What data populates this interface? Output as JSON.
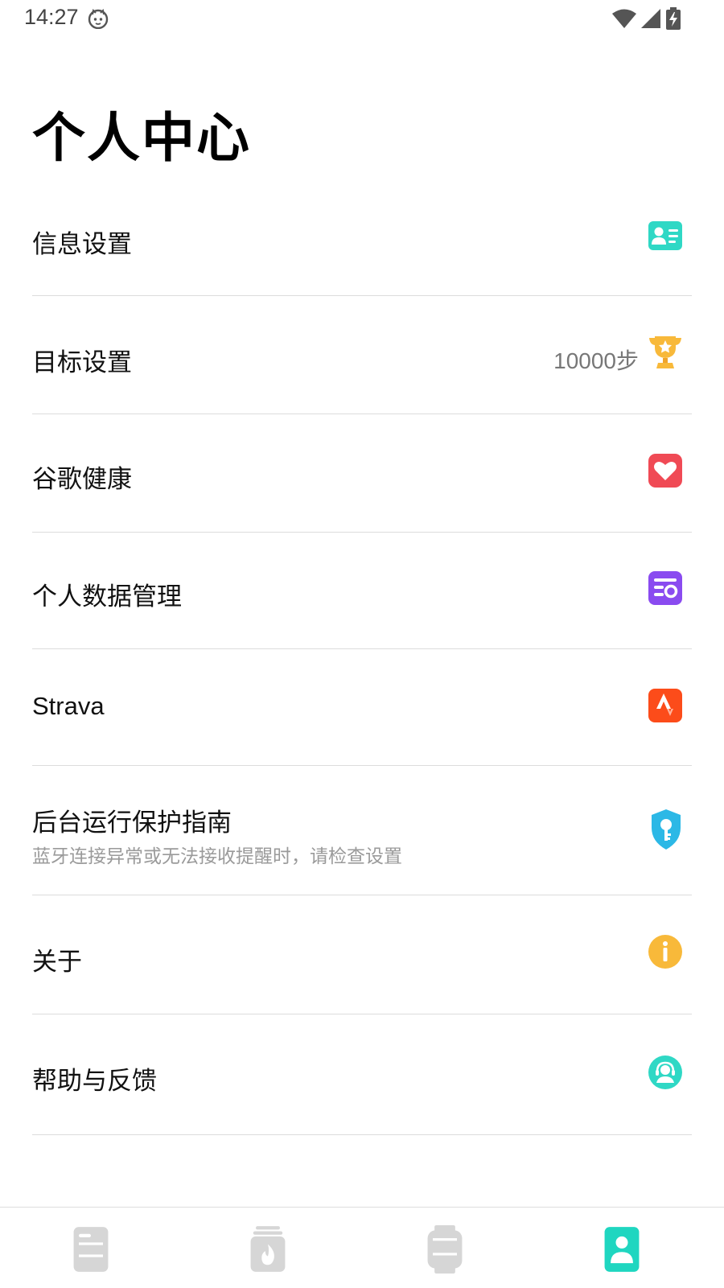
{
  "status_bar": {
    "time": "14:27"
  },
  "header": {
    "title": "个人中心"
  },
  "menu": {
    "items": [
      {
        "label": "信息设置",
        "icon": "id-card-icon",
        "color": "#2fd8c5"
      },
      {
        "label": "目标设置",
        "value": "10000步",
        "icon": "trophy-icon",
        "color": "#f8b93a"
      },
      {
        "label": "谷歌健康",
        "icon": "heart-icon",
        "color": "#f04a55"
      },
      {
        "label": "个人数据管理",
        "icon": "data-manage-icon",
        "color": "#8a4bf0"
      },
      {
        "label": "Strava",
        "icon": "strava-icon",
        "color": "#fc4c1a"
      },
      {
        "label": "后台运行保护指南",
        "sub": "蓝牙连接异常或无法接收提醒时，请检查设置",
        "icon": "shield-key-icon",
        "color": "#2cb8e6"
      },
      {
        "label": "关于",
        "icon": "info-icon",
        "color": "#f8b93a"
      },
      {
        "label": "帮助与反馈",
        "icon": "support-agent-icon",
        "color": "#2fd8c5"
      }
    ]
  },
  "bottom_nav": {
    "items": [
      {
        "icon": "dashboard-icon",
        "active": false
      },
      {
        "icon": "calories-icon",
        "active": false
      },
      {
        "icon": "watch-icon",
        "active": false
      },
      {
        "icon": "profile-icon",
        "active": true
      }
    ],
    "active_color": "#1fd6c0",
    "inactive_color": "#d6d6d6"
  }
}
